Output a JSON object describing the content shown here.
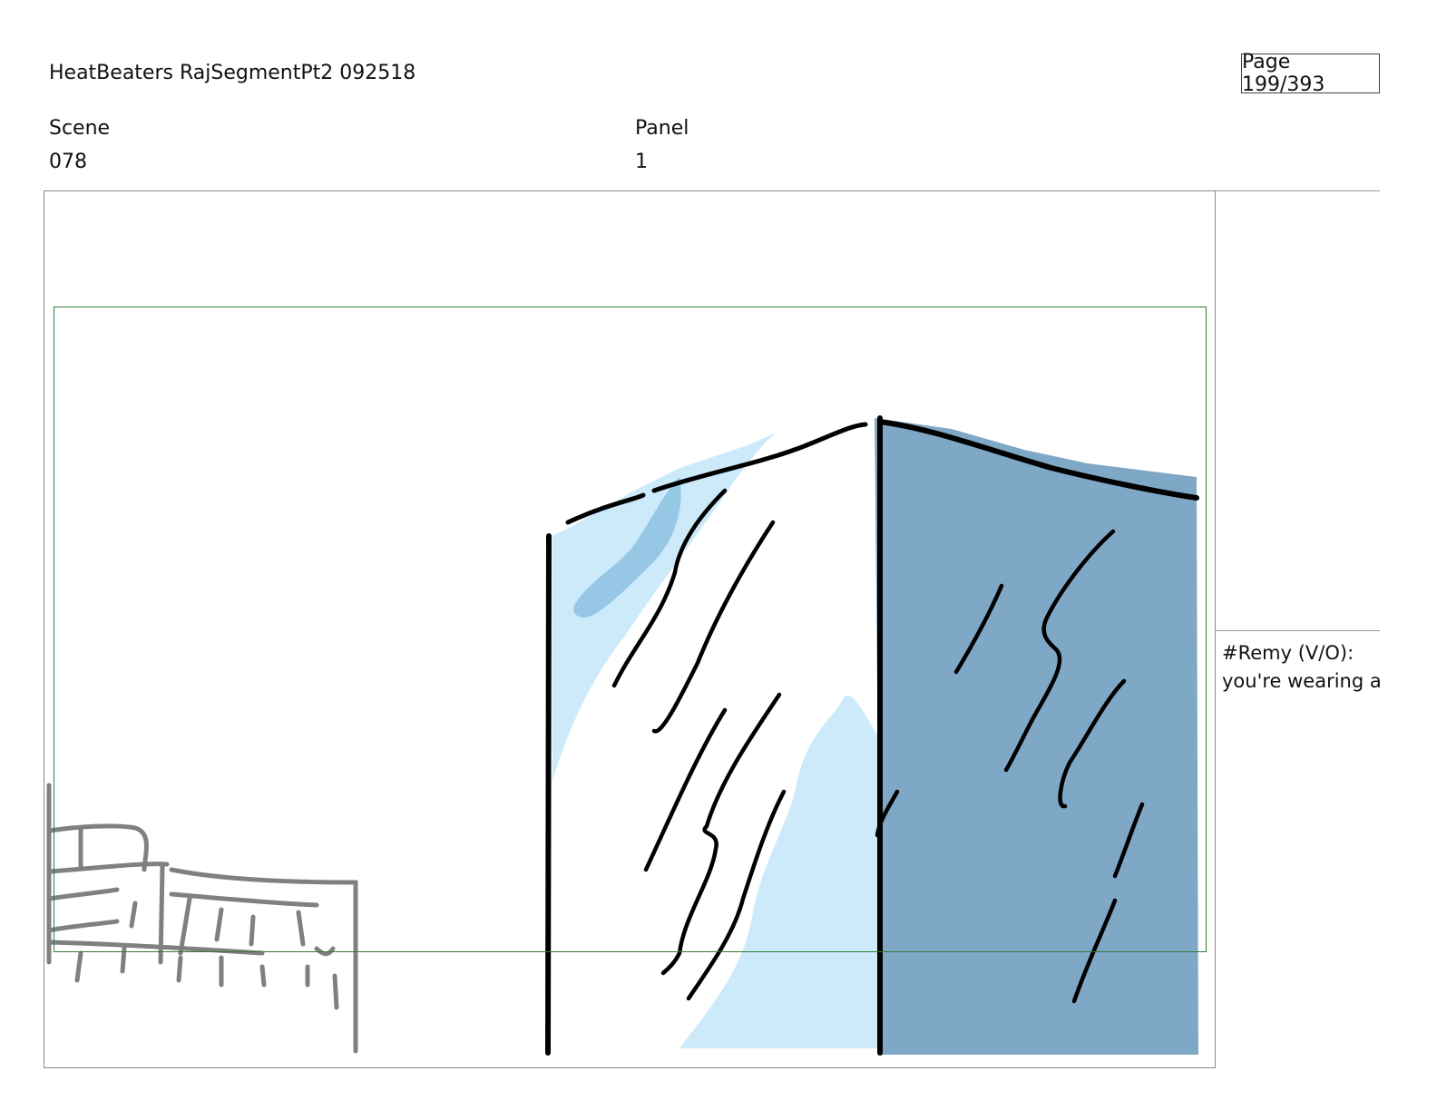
{
  "header": {
    "title": "HeatBeaters RajSegmentPt2 092518",
    "page": "Page 199/393"
  },
  "fields": {
    "scene_label": "Scene",
    "scene_value": "078",
    "panel_label": "Panel",
    "panel_value": "1"
  },
  "dialogue": {
    "speaker": "#Remy (V/O):",
    "line": "you're wearing a"
  },
  "colors": {
    "safe_area": "#2e7d32",
    "light_blue": "#cdeafb",
    "mid_blue": "#96c8e6",
    "dark_blue": "#7fa8c6",
    "ink": "#000000",
    "sketch_gray": "#808080"
  }
}
